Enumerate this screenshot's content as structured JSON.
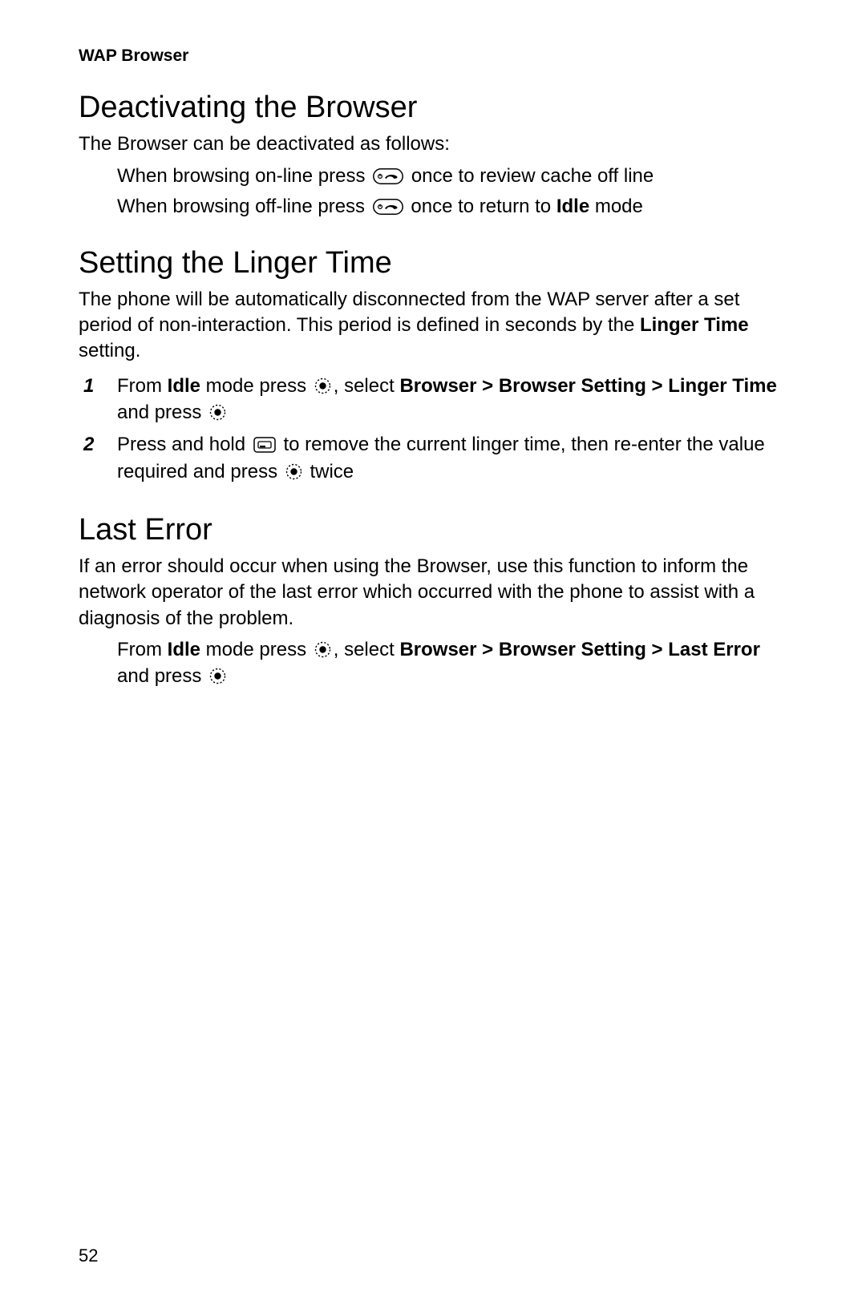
{
  "runningHead": "WAP Browser",
  "pageNumber": "52",
  "s1": {
    "title": "Deactivating the Browser",
    "intro": "The Browser can be deactivated as follows:",
    "line1a": "When browsing on-line press ",
    "line1b": " once to review cache off line",
    "line2a": "When browsing off-line press ",
    "line2b": " once to return to ",
    "line2bold": "Idle",
    "line2c": " mode"
  },
  "s2": {
    "title": "Setting the Linger Time",
    "p1a": "The phone will be automatically disconnected from the WAP server after a set period of non-interaction. This period is defined in seconds by the ",
    "p1bold": "Linger Time",
    "p1b": " setting.",
    "step1num": "1",
    "step1a": "From ",
    "step1bold1": "Idle",
    "step1b": " mode press ",
    "step1c": ", select ",
    "step1bold2": "Browser > Browser Setting > Linger Time",
    "step1d": " and press ",
    "step2num": "2",
    "step2a": "Press and hold ",
    "step2b": " to remove the current linger time, then re-enter the value required and press ",
    "step2c": " twice"
  },
  "s3": {
    "title": "Last Error",
    "p1": "If an error should occur when using the Browser, use this function to inform the network operator of the last error which occurred with the phone to assist with a diagnosis of the problem.",
    "la": "From ",
    "lbold1": "Idle",
    "lb": " mode press ",
    "lc": ", select ",
    "lbold2": "Browser > Browser Setting > Last Error",
    "ld": " and press "
  }
}
